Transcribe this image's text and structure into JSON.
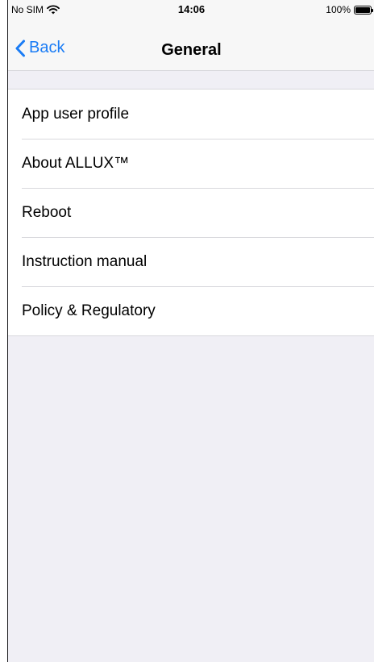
{
  "status_bar": {
    "carrier": "No SIM",
    "time": "14:06",
    "battery": "100%",
    "wifi_icon": "wifi-icon",
    "battery_icon": "battery-full-icon"
  },
  "nav": {
    "back_label": "Back",
    "title": "General",
    "back_icon": "chevron-left-icon",
    "accent_color": "#1a7cf5"
  },
  "menu": {
    "items": [
      {
        "label": "App user profile"
      },
      {
        "label": "About ALLUX™"
      },
      {
        "label": "Reboot"
      },
      {
        "label": "Instruction manual"
      },
      {
        "label": "Policy & Regulatory"
      }
    ]
  }
}
